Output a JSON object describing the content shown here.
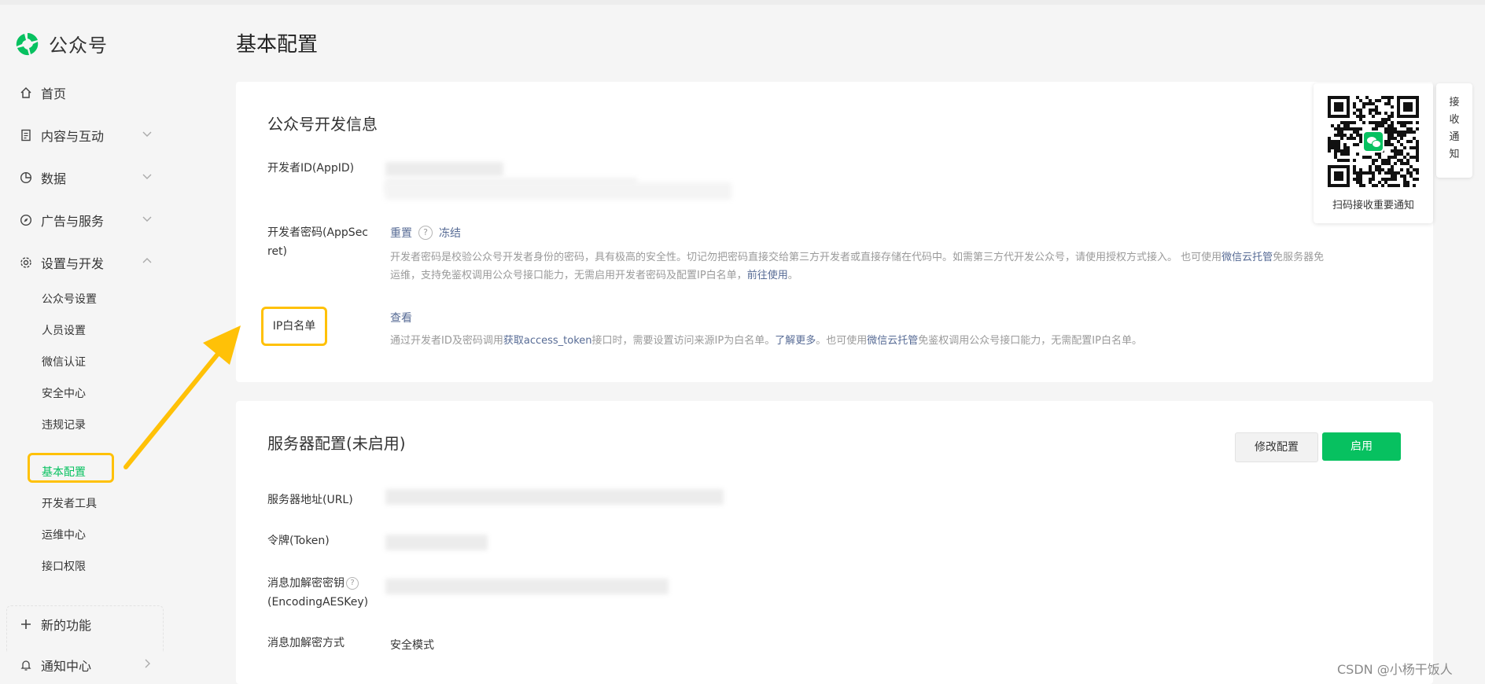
{
  "app": {
    "logo_text": "公众号"
  },
  "sidebar": {
    "home": "首页",
    "content": "内容与互动",
    "data": "数据",
    "ads": "广告与服务",
    "settings": "设置与开发",
    "sub_items": [
      "公众号设置",
      "人员设置",
      "微信认证",
      "安全中心",
      "违规记录",
      "基本配置",
      "开发者工具",
      "运维中心",
      "接口权限"
    ],
    "active_item": "基本配置",
    "new_features": "新的功能",
    "notify_center": "通知中心"
  },
  "page": {
    "title": "基本配置"
  },
  "dev_info": {
    "title": "公众号开发信息",
    "appid_label": "开发者ID(AppID)",
    "secret_label_line1": "开发者密码(AppSec",
    "secret_label_line2": "ret)",
    "reset": "重置",
    "freeze": "冻结",
    "secret_desc_1": "开发者密码是校验公众号开发者身份的密码，具有极高的安全性。切记勿把密码直接交给第三方开发者或直接存储在代码中。如需第三方代开发公众号，请使用授权方式接入。 也可使用",
    "secret_desc_link1": "微信云托管",
    "secret_desc_2": "免服务器免",
    "secret_desc_3": "运维，支持免鉴权调用公众号接口能力，无需启用开发者密码及配置IP白名单，",
    "secret_desc_link2": "前往使用",
    "secret_desc_end": "。",
    "ip_label": "IP白名单",
    "ip_view": "查看",
    "ip_desc_1": "通过开发者ID及密码调用",
    "ip_desc_link1": "获取access_token",
    "ip_desc_2": "接口时，需要设置访问来源IP为白名单。",
    "ip_desc_link2": "了解更多",
    "ip_desc_3": "。也可使用",
    "ip_desc_link3": "微信云托管",
    "ip_desc_4": "免鉴权调用公众号接口能力，无需配置IP白名单。"
  },
  "server": {
    "title": "服务器配置(未启用)",
    "modify_btn": "修改配置",
    "enable_btn": "启用",
    "url_label": "服务器地址(URL)",
    "token_label": "令牌(Token)",
    "aes_label_line1": "消息加解密密钥",
    "aes_label_line2": "(EncodingAESKey)",
    "mode_label": "消息加解密方式",
    "mode_value": "安全模式"
  },
  "qr": {
    "caption": "扫码接收重要通知"
  },
  "notify_tab": {
    "chars": [
      "接",
      "收",
      "通",
      "知"
    ]
  },
  "watermark": "CSDN @小杨干饭人",
  "colors": {
    "accent": "#07c160",
    "link": "#576b95",
    "highlight": "#ffc107"
  }
}
